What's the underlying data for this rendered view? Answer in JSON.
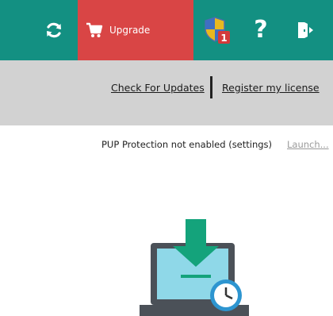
{
  "toolbar": {
    "refresh_icon": "refresh-icon",
    "upgrade_label": "Upgrade",
    "upgrade_icon": "cart-icon",
    "upgrade_bg": "#d94545",
    "shield_icon": "shield-icon",
    "shield_badge": "1",
    "help_label": "?",
    "exit_icon": "exit-icon",
    "bg": "#139082"
  },
  "links": {
    "check_updates": "Check For Updates",
    "register": "Register my license"
  },
  "pup": {
    "status": "PUP Protection not enabled (settings)",
    "launch": "Launch..."
  },
  "illustration": {
    "icon": "laptop-download-clock-icon"
  }
}
